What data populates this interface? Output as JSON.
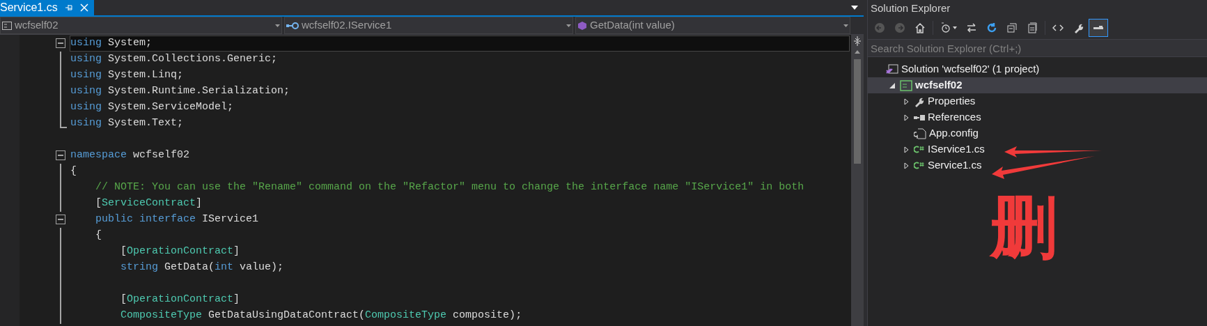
{
  "editor": {
    "tab": {
      "label": "Service1.cs",
      "selected": true
    },
    "dropdowns": [
      {
        "kind": "project",
        "text": "wcfself02"
      },
      {
        "kind": "class",
        "text": "wcfself02.IService1"
      },
      {
        "kind": "method",
        "text": "GetData(int value)"
      }
    ],
    "lines": [
      {
        "kind": "fold-start",
        "current": true,
        "tokens": [
          {
            "kind": "keyword",
            "text": "using"
          },
          {
            "kind": "plain",
            "text": " System;"
          }
        ]
      },
      {
        "kind": "fold-body",
        "current": false,
        "tokens": [
          {
            "kind": "keyword",
            "text": "using"
          },
          {
            "kind": "plain",
            "text": " System.Collections.Generic;"
          }
        ]
      },
      {
        "kind": "fold-body",
        "current": false,
        "tokens": [
          {
            "kind": "keyword",
            "text": "using"
          },
          {
            "kind": "plain",
            "text": " System.Linq;"
          }
        ]
      },
      {
        "kind": "fold-body",
        "current": false,
        "tokens": [
          {
            "kind": "keyword",
            "text": "using"
          },
          {
            "kind": "plain",
            "text": " System.Runtime.Serialization;"
          }
        ]
      },
      {
        "kind": "fold-body",
        "current": false,
        "tokens": [
          {
            "kind": "keyword",
            "text": "using"
          },
          {
            "kind": "plain",
            "text": " System.ServiceModel;"
          }
        ]
      },
      {
        "kind": "fold-end",
        "current": false,
        "tokens": [
          {
            "kind": "keyword",
            "text": "using"
          },
          {
            "kind": "plain",
            "text": " System.Text;"
          }
        ]
      },
      {
        "kind": "plain",
        "current": false
      },
      {
        "kind": "fold-start",
        "current": false,
        "tokens": [
          {
            "kind": "keyword",
            "text": "namespace"
          },
          {
            "kind": "plain",
            "text": " wcfself02"
          }
        ]
      },
      {
        "kind": "fold-body",
        "current": false,
        "tokens": [
          {
            "kind": "plain",
            "text": "{"
          }
        ]
      },
      {
        "kind": "fold-body",
        "current": false,
        "tokens": [
          {
            "kind": "comment",
            "text": "    // NOTE: You can use the \"Rename\" command on the \"Refactor\" menu to change the interface name \"IService1\" in both"
          }
        ]
      },
      {
        "kind": "fold-body",
        "current": false,
        "tokens": [
          {
            "kind": "plain",
            "text": "    ["
          },
          {
            "kind": "type",
            "text": "ServiceContract"
          },
          {
            "kind": "plain",
            "text": "]"
          }
        ]
      },
      {
        "kind": "fold-start",
        "current": false,
        "tokens": [
          {
            "kind": "keyword",
            "text": "    public interface"
          },
          {
            "kind": "plain",
            "text": " IService1"
          }
        ]
      },
      {
        "kind": "fold-body",
        "current": false,
        "tokens": [
          {
            "kind": "plain",
            "text": "    {"
          }
        ]
      },
      {
        "kind": "fold-body",
        "current": false,
        "tokens": [
          {
            "kind": "plain",
            "text": "        ["
          },
          {
            "kind": "type",
            "text": "OperationContract"
          },
          {
            "kind": "plain",
            "text": "]"
          }
        ]
      },
      {
        "kind": "fold-body",
        "current": false,
        "tokens": [
          {
            "kind": "keyword",
            "text": "        string"
          },
          {
            "kind": "plain",
            "text": " GetData("
          },
          {
            "kind": "keyword",
            "text": "int"
          },
          {
            "kind": "plain",
            "text": " value);"
          }
        ]
      },
      {
        "kind": "fold-body",
        "current": false
      },
      {
        "kind": "fold-body",
        "current": false,
        "tokens": [
          {
            "kind": "plain",
            "text": "        ["
          },
          {
            "kind": "type",
            "text": "OperationContract"
          },
          {
            "kind": "plain",
            "text": "]"
          }
        ]
      },
      {
        "kind": "fold-body",
        "current": false,
        "tokens": [
          {
            "kind": "type",
            "text": "        CompositeType"
          },
          {
            "kind": "plain",
            "text": " GetDataUsingDataContract("
          },
          {
            "kind": "type",
            "text": "CompositeType"
          },
          {
            "kind": "plain",
            "text": " composite);"
          }
        ]
      }
    ]
  },
  "solution_explorer": {
    "title": "Solution Explorer",
    "toolbar": [
      {
        "kind": "back",
        "disabled": true,
        "selected": false
      },
      {
        "kind": "forward",
        "disabled": true,
        "selected": false
      },
      {
        "kind": "home",
        "disabled": false,
        "selected": false
      },
      {
        "kind": "history",
        "disabled": false,
        "selected": false
      },
      {
        "kind": "sync",
        "disabled": false,
        "selected": false
      },
      {
        "kind": "refresh",
        "disabled": false,
        "selected": false
      },
      {
        "kind": "collapse",
        "disabled": false,
        "selected": false
      },
      {
        "kind": "show-all",
        "disabled": false,
        "selected": false
      },
      {
        "kind": "code",
        "disabled": false,
        "selected": false
      },
      {
        "kind": "properties",
        "disabled": false,
        "selected": false
      },
      {
        "kind": "preview",
        "disabled": false,
        "selected": true
      }
    ],
    "search": {
      "placeholder": "Search Solution Explorer (Ctrl+;)"
    },
    "tree": [
      {
        "label": "Solution 'wcfself02' (1 project)",
        "kind": "solution",
        "selected": false,
        "children": [
          {
            "label": "wcfself02",
            "kind": "project",
            "expanded": true,
            "selected": true,
            "children": [
              {
                "label": "Properties",
                "kind": "properties",
                "expanded": false,
                "selected": false
              },
              {
                "label": "References",
                "kind": "references",
                "expanded": false,
                "selected": false
              },
              {
                "label": "App.config",
                "kind": "config",
                "selected": false
              },
              {
                "label": "IService1.cs",
                "kind": "csharp",
                "expanded": false,
                "selected": false
              },
              {
                "label": "Service1.cs",
                "kind": "csharp",
                "expanded": false,
                "selected": false
              }
            ]
          }
        ]
      }
    ]
  },
  "annotation": {
    "text": "删"
  }
}
